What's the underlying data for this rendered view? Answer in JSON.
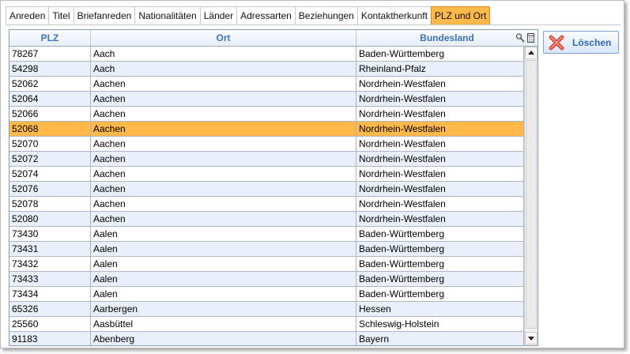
{
  "tabs": [
    {
      "label": "Anreden",
      "active": false
    },
    {
      "label": "Titel",
      "active": false
    },
    {
      "label": "Briefanreden",
      "active": false
    },
    {
      "label": "Nationalitäten",
      "active": false
    },
    {
      "label": "Länder",
      "active": false
    },
    {
      "label": "Adressarten",
      "active": false
    },
    {
      "label": "Beziehungen",
      "active": false
    },
    {
      "label": "Kontaktherkunft",
      "active": false
    },
    {
      "label": "PLZ und Ort",
      "active": true
    }
  ],
  "table": {
    "columns": [
      "PLZ",
      "Ort",
      "Bundesland"
    ],
    "selected_index": 5,
    "rows": [
      [
        "78267",
        "Aach",
        "Baden-Württemberg"
      ],
      [
        "54298",
        "Aach",
        "Rheinland-Pfalz"
      ],
      [
        "52062",
        "Aachen",
        "Nordrhein-Westfalen"
      ],
      [
        "52064",
        "Aachen",
        "Nordrhein-Westfalen"
      ],
      [
        "52066",
        "Aachen",
        "Nordrhein-Westfalen"
      ],
      [
        "52068",
        "Aachen",
        "Nordrhein-Westfalen"
      ],
      [
        "52070",
        "Aachen",
        "Nordrhein-Westfalen"
      ],
      [
        "52072",
        "Aachen",
        "Nordrhein-Westfalen"
      ],
      [
        "52074",
        "Aachen",
        "Nordrhein-Westfalen"
      ],
      [
        "52076",
        "Aachen",
        "Nordrhein-Westfalen"
      ],
      [
        "52078",
        "Aachen",
        "Nordrhein-Westfalen"
      ],
      [
        "52080",
        "Aachen",
        "Nordrhein-Westfalen"
      ],
      [
        "73430",
        "Aalen",
        "Baden-Württemberg"
      ],
      [
        "73431",
        "Aalen",
        "Baden-Württemberg"
      ],
      [
        "73432",
        "Aalen",
        "Baden-Württemberg"
      ],
      [
        "73433",
        "Aalen",
        "Baden-Württemberg"
      ],
      [
        "73434",
        "Aalen",
        "Baden-Württemberg"
      ],
      [
        "65326",
        "Aarbergen",
        "Hessen"
      ],
      [
        "25560",
        "Aasbüttel",
        "Schleswig-Holstein"
      ],
      [
        "91183",
        "Abenberg",
        "Bayern"
      ]
    ]
  },
  "header_icons": [
    "search-icon",
    "column-chooser-icon"
  ],
  "delete_button": {
    "label": "Löschen",
    "icon": "red-x-icon"
  },
  "colors": {
    "selection": "#ffb84a",
    "header_text": "#3b73b9",
    "alt_row": "#e9f0fb"
  }
}
